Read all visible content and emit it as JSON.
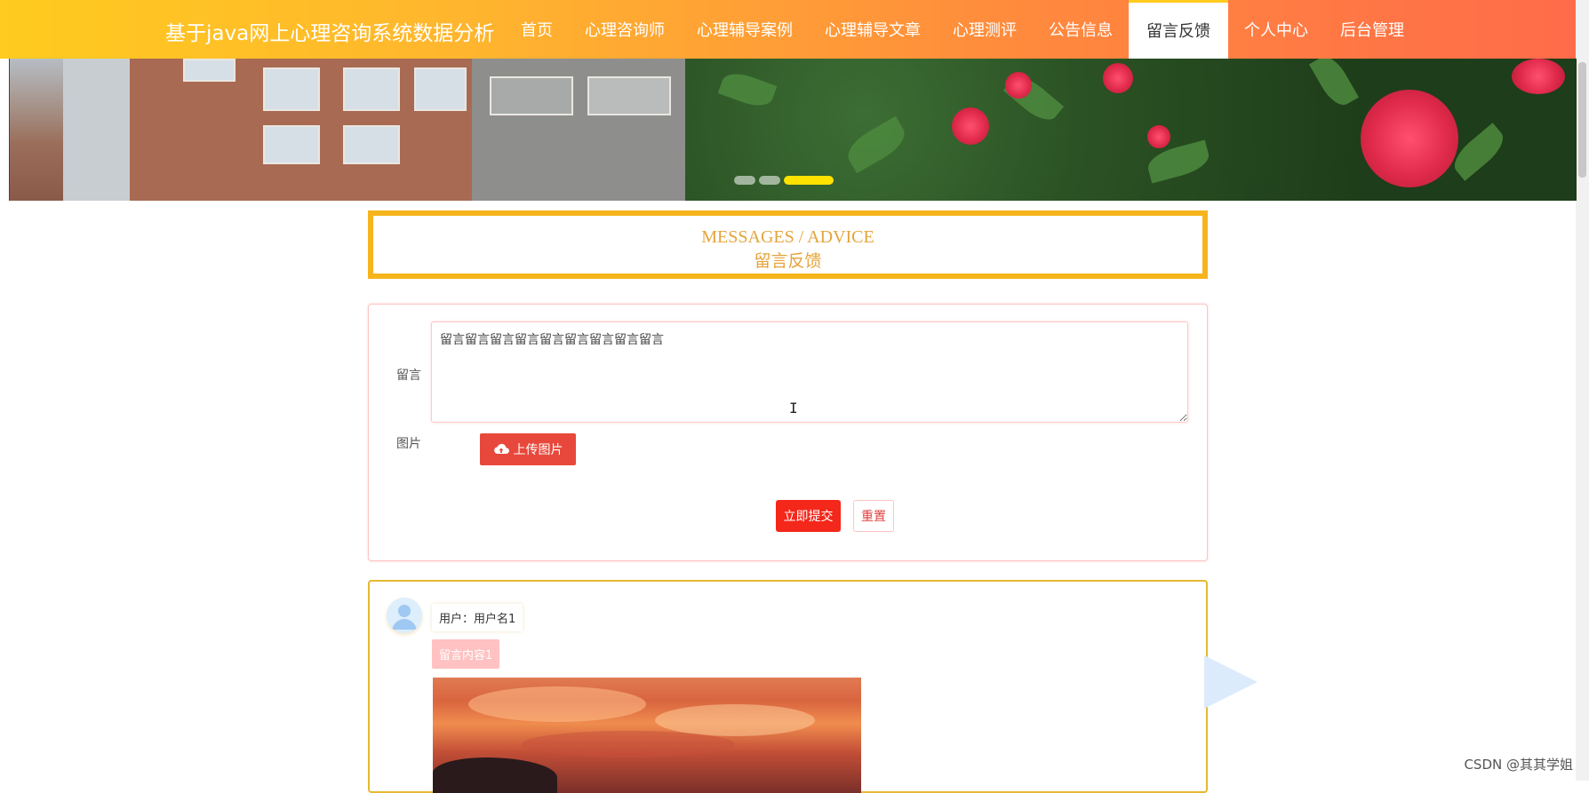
{
  "header": {
    "site_title": "基于java网上心理咨询系统数据分析",
    "nav": [
      {
        "label": "首页"
      },
      {
        "label": "心理咨询师"
      },
      {
        "label": "心理辅导案例"
      },
      {
        "label": "心理辅导文章"
      },
      {
        "label": "心理测评"
      },
      {
        "label": "公告信息"
      },
      {
        "label": "留言反馈",
        "active": true
      },
      {
        "label": "个人中心"
      },
      {
        "label": "后台管理"
      }
    ]
  },
  "section_title": {
    "en": "MESSAGES / ADVICE",
    "cn": "留言反馈"
  },
  "form": {
    "message_label": "留言",
    "message_value": "留言留言留言留言留言留言留言留言留言",
    "image_label": "图片",
    "upload_label": "上传图片",
    "submit_label": "立即提交",
    "reset_label": "重置"
  },
  "messages": [
    {
      "user_text": "用户：用户名1",
      "content": "留言内容1"
    }
  ],
  "watermark": "CSDN @其其学姐",
  "colors": {
    "accent_yellow": "#f6b51c",
    "submit_red": "#f4271b",
    "upload_red": "#e8483b"
  },
  "carousel": {
    "slide_count": 3,
    "active_index": 2
  }
}
